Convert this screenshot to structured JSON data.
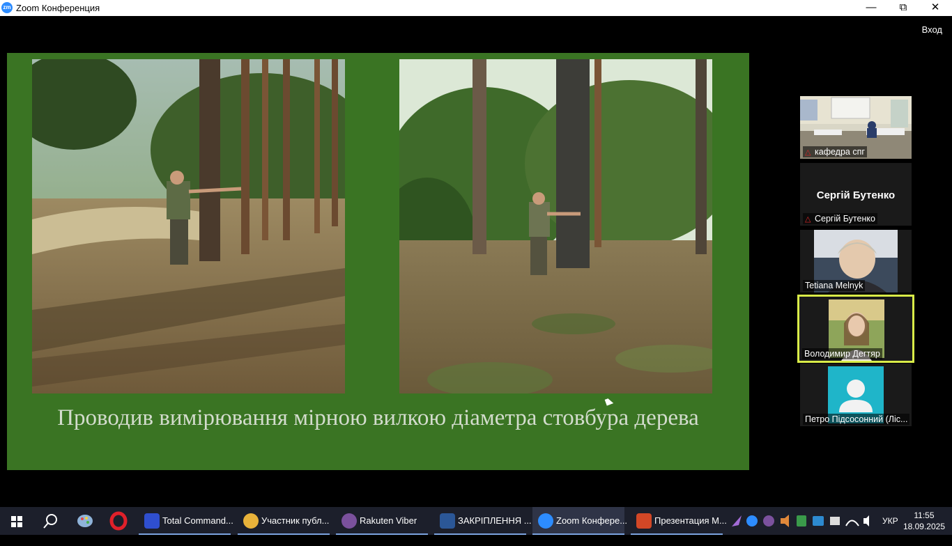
{
  "window": {
    "title": "Zoom Конференция",
    "exit_label": "Вход"
  },
  "slide": {
    "background": "#3a7423",
    "caption": "Проводив вимірювання мірною вилкою діаметра стовбура дерева"
  },
  "participants": [
    {
      "name": "кафедра спг",
      "muted": true,
      "video": "classroom"
    },
    {
      "name": "Сергій Бутенко",
      "muted": true,
      "video": "none",
      "display_name": "Сергій Бутенко"
    },
    {
      "name": "Tetiana Melnyk",
      "muted": false,
      "video": "person"
    },
    {
      "name": "Володимир Дегтяр",
      "muted": false,
      "video": "person",
      "speaking": true
    },
    {
      "name": "Петро Підсосонний (Ліс...",
      "muted": false,
      "video": "avatar"
    }
  ],
  "taskbar": {
    "items": [
      {
        "label": "Total Command...",
        "icon": "total-commander-icon",
        "color": "#2f4fcf"
      },
      {
        "label": "Участник публ...",
        "icon": "chrome-icon",
        "color": "#e8b23a"
      },
      {
        "label": "Rakuten Viber",
        "icon": "viber-icon",
        "color": "#7b519d"
      },
      {
        "label": "ЗАКРІПЛЕННЯ ...",
        "icon": "word-icon",
        "color": "#2b5797"
      },
      {
        "label": "Zoom Конфере...",
        "icon": "zoom-icon",
        "color": "#2d8cff"
      },
      {
        "label": "Презентация М...",
        "icon": "powerpoint-icon",
        "color": "#d24726"
      }
    ],
    "language": "УКР",
    "time": "11:55",
    "date": "18.09.2025"
  }
}
